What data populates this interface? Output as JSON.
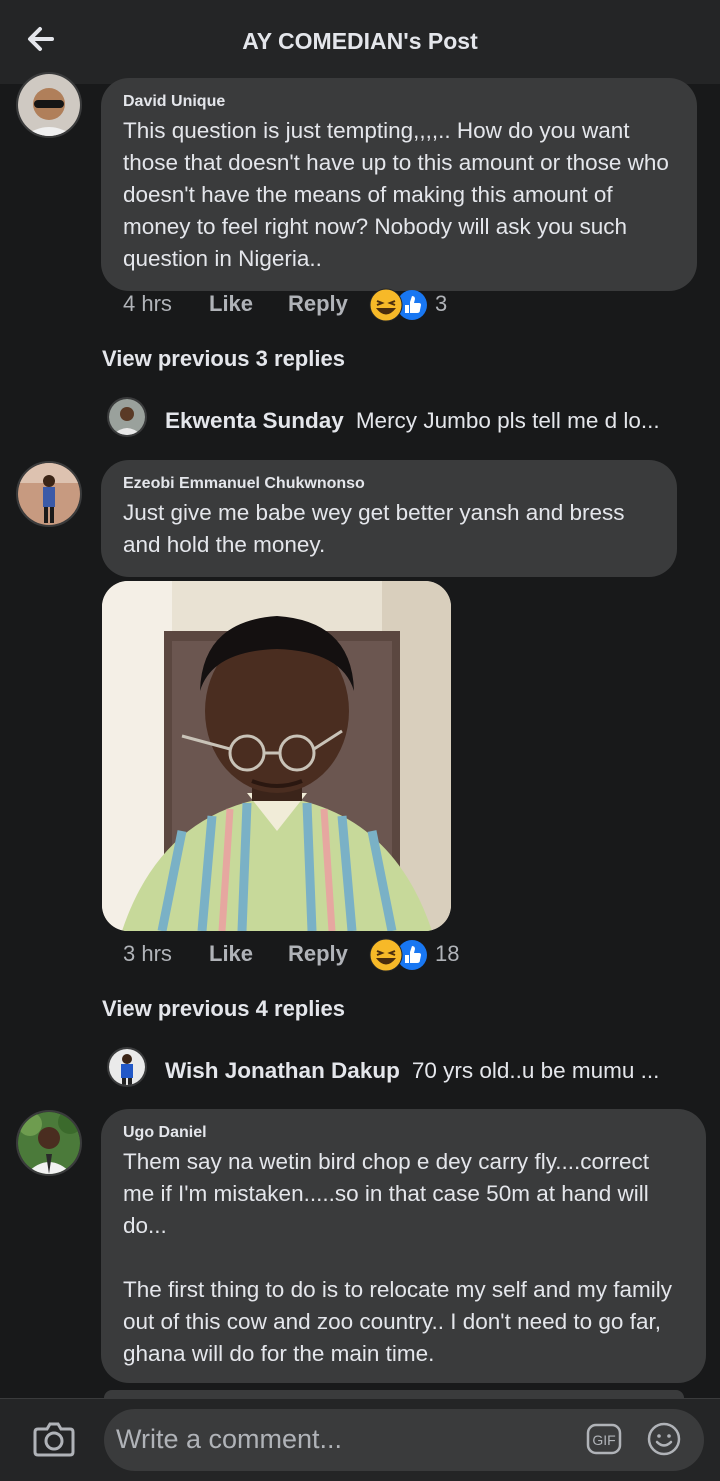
{
  "header": {
    "title": "AY COMEDIAN's Post"
  },
  "comments": [
    {
      "author": "David Unique",
      "text": "This question is just tempting,,,,.. How do you want those that doesn't have up to this amount or those who doesn't have the means of making this amount of money to feel right now? Nobody will ask you such question in Nigeria..",
      "time": "4 hrs",
      "like": "Like",
      "reply": "Reply",
      "reaction_count": "3"
    },
    {
      "author": "Ezeobi Emmanuel Chukwnonso",
      "text": "Just give me babe wey get better yansh and bress and hold the money.",
      "time": "3 hrs",
      "like": "Like",
      "reply": "Reply",
      "reaction_count": "18"
    },
    {
      "author": "Ugo Daniel",
      "text": "Them say na wetin bird chop e dey carry fly....correct me if I'm mistaken.....so in that case 50m at hand will do...\n\nThe first thing to do is to relocate my self and my family out of this cow and zoo country.. I don't need to go far, ghana will do for the main time."
    }
  ],
  "reply_previews": [
    {
      "view_previous": "View previous 3 replies",
      "author": "Ekwenta Sunday",
      "snippet": "Mercy Jumbo pls tell me d lo..."
    },
    {
      "view_previous": "View previous 4 replies",
      "author": "Wish Jonathan Dakup",
      "snippet": "70 yrs old..u be mumu ..."
    }
  ],
  "composer": {
    "placeholder": "Write a comment...",
    "gif_label": "GIF"
  },
  "icons": {
    "back": "back-arrow-icon",
    "camera": "camera-icon",
    "gif": "gif-icon",
    "emoji": "emoji-icon",
    "reactions": [
      "laughing-face-icon",
      "thumbs-up-icon"
    ]
  },
  "colors": {
    "background": "#18191a",
    "bubble": "#3a3b3c",
    "bar": "#242526",
    "like_blue": "#1877f2",
    "haha_yellow": "#f7b928"
  }
}
